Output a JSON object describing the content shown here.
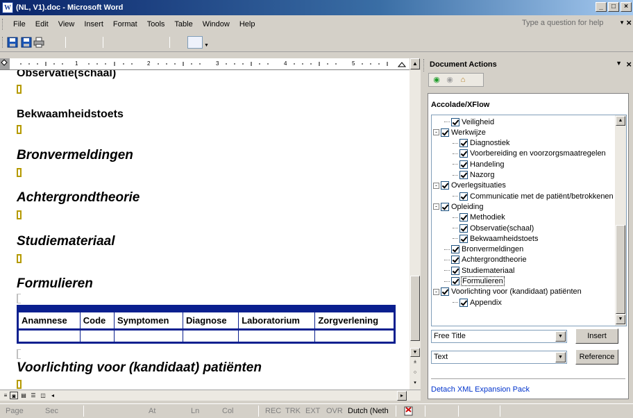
{
  "window": {
    "title": "(NL, V1).doc - Microsoft Word",
    "app_icon_letter": "W",
    "controls": [
      "_",
      "□",
      "×"
    ]
  },
  "menubar": {
    "items": [
      "File",
      "Edit",
      "View",
      "Insert",
      "Format",
      "Tools",
      "Table",
      "Window",
      "Help"
    ],
    "help_placeholder": "Type a question for help",
    "help_arrow": "▼",
    "close": "×"
  },
  "ruler": {
    "numbers": [
      "1",
      "2",
      "3",
      "4",
      "5"
    ]
  },
  "document": {
    "top_partial_heading": "Observatie(schaal)",
    "headings": [
      {
        "text": "Bekwaamheidstoets",
        "style": "heading2"
      },
      {
        "text": "Bronvermeldingen",
        "style": "heading1"
      },
      {
        "text": "Achtergrondtheorie",
        "style": "heading1"
      },
      {
        "text": "Studiemateriaal",
        "style": "heading1"
      },
      {
        "text": "Formulieren",
        "style": "heading1"
      },
      {
        "text": "Voorlichting voor (kandidaat) patiënten",
        "style": "heading1"
      }
    ],
    "table": {
      "columns": [
        "Anamnese",
        "Code",
        "Symptomen",
        "Diagnose",
        "Laboratorium",
        "Zorgverlening"
      ],
      "rows": [
        [
          "",
          "",
          "",
          "",
          "",
          ""
        ]
      ]
    }
  },
  "statusbar": {
    "page": "Page",
    "sec": "Sec",
    "at": "At",
    "ln": "Ln",
    "col": "Col",
    "rec": "REC",
    "trk": "TRK",
    "ext": "EXT",
    "ovr": "OVR",
    "language": "Dutch (Neth"
  },
  "taskpane": {
    "title": "Document Actions",
    "menu_arrow": "▼",
    "close": "×",
    "section_title": "Accolade/XFlow",
    "tree": [
      {
        "label": "Veiligheid",
        "level": 1,
        "expander": ""
      },
      {
        "label": "Werkwijze",
        "level": 0,
        "expander": "-"
      },
      {
        "label": "Diagnostiek",
        "level": 2,
        "expander": ""
      },
      {
        "label": "Voorbereiding en voorzorgsmaatregelen",
        "level": 2,
        "expander": ""
      },
      {
        "label": "Handeling",
        "level": 2,
        "expander": ""
      },
      {
        "label": "Nazorg",
        "level": 2,
        "expander": ""
      },
      {
        "label": "Overlegsituaties",
        "level": 0,
        "expander": "-"
      },
      {
        "label": "Communicatie met de patiënt/betrokkenen",
        "level": 2,
        "expander": ""
      },
      {
        "label": "Opleiding",
        "level": 0,
        "expander": "-"
      },
      {
        "label": "Methodiek",
        "level": 2,
        "expander": ""
      },
      {
        "label": "Observatie(schaal)",
        "level": 2,
        "expander": ""
      },
      {
        "label": "Bekwaamheidstoets",
        "level": 2,
        "expander": ""
      },
      {
        "label": "Bronvermeldingen",
        "level": 1,
        "expander": ""
      },
      {
        "label": "Achtergrondtheorie",
        "level": 1,
        "expander": ""
      },
      {
        "label": "Studiemateriaal",
        "level": 1,
        "expander": ""
      },
      {
        "label": "Formulieren",
        "level": 1,
        "expander": "",
        "selected": true
      },
      {
        "label": "Voorlichting voor (kandidaat) patiënten",
        "level": 0,
        "expander": "-"
      },
      {
        "label": "Appendix",
        "level": 2,
        "expander": ""
      }
    ],
    "element_select": "Free Title",
    "insert_button": "Insert",
    "attr_select": "Text",
    "reference_button": "Reference",
    "detach_link": "Detach XML Expansion Pack"
  },
  "colors": {
    "accent": "#0a246a",
    "table_border": "#0a1f8f",
    "para_mark": "#b59a00"
  }
}
